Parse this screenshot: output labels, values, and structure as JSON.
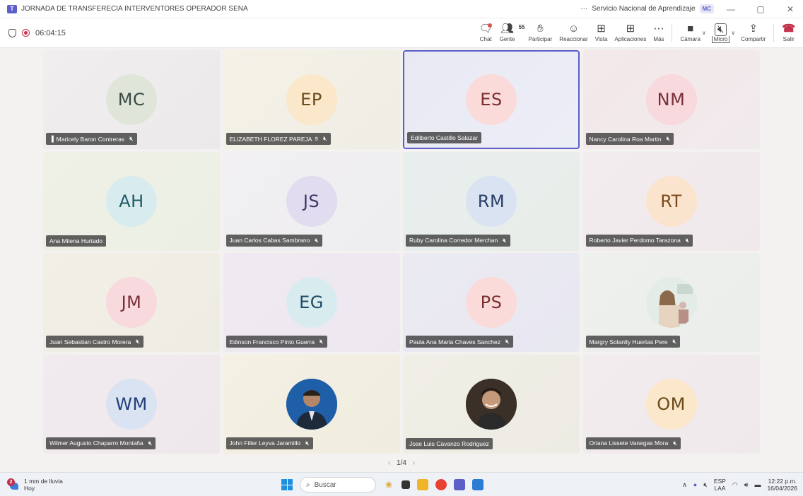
{
  "window": {
    "title": "JORNADA DE TRANSFERECIA INTERVENTORES OPERADOR SENA",
    "more": "···",
    "org": "Servicio Nacional de Aprendizaje",
    "user_badge": "MC",
    "controls": [
      "—",
      "▢",
      "✕"
    ]
  },
  "meeting": {
    "timer": "06:04:15"
  },
  "toolbar": {
    "chat": "Chat",
    "people": "Gente",
    "people_count": "55",
    "raise": "Participar",
    "react": "Reaccionar",
    "view": "Vista",
    "apps": "Aplicaciones",
    "more": "Más",
    "camera": "Cámara",
    "mic": "Micro",
    "share": "Compartir",
    "leave": "Salir"
  },
  "participants": [
    {
      "initials": "MC",
      "name": "Maricely Baron Contreras",
      "muted": true,
      "signal": true,
      "avatar_bg": "#dfe6d9",
      "initials_color": "#3a4a42",
      "tile_bg": "linear-gradient(135deg,#f1eef0,#ece9ea)"
    },
    {
      "initials": "EP",
      "name": "ELIZABETH FLOREZ PAREJA",
      "muted": true,
      "handicon": true,
      "avatar_bg": "#fbe7c9",
      "initials_color": "#6b4a1c",
      "tile_bg": "linear-gradient(135deg,#f5f1e7,#efede4)"
    },
    {
      "initials": "ES",
      "name": "Edilberto Castillo Salazar",
      "muted": false,
      "active": true,
      "avatar_bg": "#fbdada",
      "initials_color": "#7a2f2f",
      "tile_bg": "linear-gradient(135deg,#e9e9f4,#eceef6)"
    },
    {
      "initials": "NM",
      "name": "Nancy Carolina Roa Martin",
      "muted": true,
      "avatar_bg": "#f8d9dd",
      "initials_color": "#7a2f38",
      "tile_bg": "linear-gradient(135deg,#f3e8ea,#f1eaec)"
    },
    {
      "initials": "AH",
      "name": "Ana Milena Hurtado",
      "muted": false,
      "avatar_bg": "#d8ecef",
      "initials_color": "#1f5a66",
      "tile_bg": "linear-gradient(135deg,#eff1e6,#ecefe4)"
    },
    {
      "initials": "JS",
      "name": "Juan Carlos Cabas Sambrano",
      "muted": true,
      "avatar_bg": "#e1dcef",
      "initials_color": "#3f3766",
      "tile_bg": "linear-gradient(135deg,#f1eff1,#eeeef0)"
    },
    {
      "initials": "RM",
      "name": "Ruby Carolina Corredor Merchan",
      "muted": true,
      "avatar_bg": "#d9e3f1",
      "initials_color": "#2a3f66",
      "tile_bg": "linear-gradient(135deg,#e8eeee,#e9ede9)"
    },
    {
      "initials": "RT",
      "name": "Roberto Javier Perdomo Tarazona",
      "muted": true,
      "avatar_bg": "#fbe4cd",
      "initials_color": "#7a4a1c",
      "tile_bg": "linear-gradient(135deg,#f3ecee,#efe9ec)"
    },
    {
      "initials": "JM",
      "name": "Juan Sebastian Castro Morera",
      "muted": true,
      "avatar_bg": "#f8d9dd",
      "initials_color": "#7a2f38",
      "tile_bg": "linear-gradient(135deg,#f1efe6,#efece3)"
    },
    {
      "initials": "EG",
      "name": "Edinson Francisco Pinto Guerra",
      "muted": true,
      "avatar_bg": "#d8ecef",
      "initials_color": "#1f4a66",
      "tile_bg": "linear-gradient(135deg,#f0e9f1,#ede8ef)"
    },
    {
      "initials": "PS",
      "name": "Paula Ana Maria Chaves Sanchez",
      "muted": true,
      "avatar_bg": "#fbdada",
      "initials_color": "#7a2f2f",
      "tile_bg": "linear-gradient(135deg,#ebeaf3,#e8e8f1)"
    },
    {
      "initials": "",
      "name": "Margry Solanlly Huertas Pere",
      "muted": true,
      "photo": "woman",
      "avatar_bg": "#dfe8e2",
      "tile_bg": "linear-gradient(135deg,#eef0ee,#ebeeeb)"
    },
    {
      "initials": "WM",
      "name": "Wilmer Augusto Chaparro Montaña",
      "muted": true,
      "avatar_bg": "#d9e3f1",
      "initials_color": "#1f3f7a",
      "tile_bg": "linear-gradient(135deg,#f1eaee,#eee8ec)"
    },
    {
      "initials": "",
      "name": "John Filler Leyva Jaramillo",
      "muted": true,
      "photo": "man1",
      "avatar_bg": "#1e5fa8",
      "tile_bg": "linear-gradient(135deg,#f4f0e3,#f0ecdf)"
    },
    {
      "initials": "",
      "name": "Jose Luis Cavanzo Rodriguez",
      "muted": false,
      "photo": "man2",
      "avatar_bg": "#3b3028",
      "tile_bg": "linear-gradient(135deg,#f0efe6,#edebe3)"
    },
    {
      "initials": "OM",
      "name": "Oriana Lissete Vanegas Mora",
      "muted": true,
      "avatar_bg": "#fbe7c9",
      "initials_color": "#6b4a1c",
      "tile_bg": "linear-gradient(135deg,#f2ecee,#efe9eb)"
    }
  ],
  "pager": {
    "label": "1/4",
    "prev": "‹",
    "next": "›"
  },
  "taskbar": {
    "weather_badge": "2",
    "weather_text": "1 mm de lluvia",
    "weather_sub": "Hoy",
    "search_placeholder": "Buscar",
    "lang_top": "ESP",
    "lang_bottom": "LAA",
    "time": "12:22 p.m.",
    "date": "16/04/2026"
  }
}
